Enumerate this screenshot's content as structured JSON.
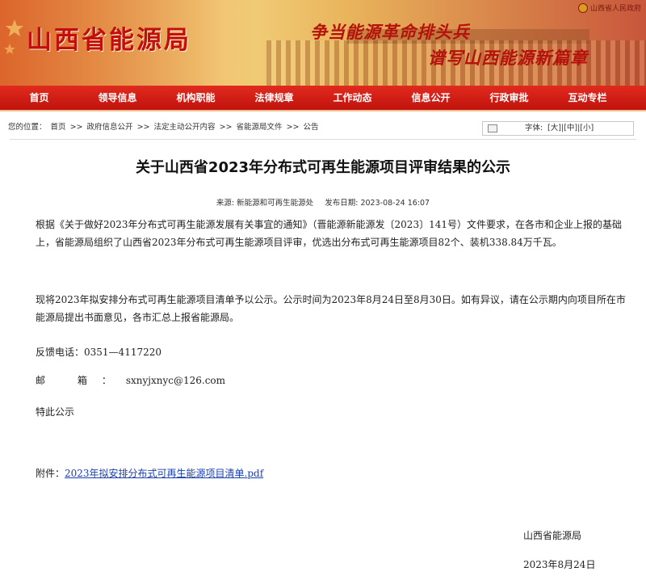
{
  "header": {
    "site_title": "山西省能源局",
    "slogan_line1": "争当能源革命排头兵",
    "slogan_line2": "谱写山西能源新篇章",
    "gov_link": "山西省人民政府"
  },
  "nav": {
    "items": [
      "首页",
      "领导信息",
      "机构职能",
      "法律规章",
      "工作动态",
      "信息公开",
      "行政审批",
      "互动专栏"
    ]
  },
  "breadcrumb": {
    "prefix": "您的位置：",
    "items": [
      "首页",
      "政府信息公开",
      "法定主动公开内容",
      "省能源局文件",
      "公告"
    ],
    "separator": ">>"
  },
  "font_size": {
    "label": "字体:",
    "options": [
      "大",
      "中",
      "小"
    ]
  },
  "article": {
    "title": "关于山西省2023年分布式可再生能源项目评审结果的公示",
    "source_label": "来源:",
    "source": "新能源和可再生能源处",
    "date_label": "发布日期:",
    "date": "2023-08-24 16:07",
    "paragraph1": "根据《关于做好2023年分布式可再生能源发展有关事宜的通知》（晋能源新能源发〔2023〕141号）文件要求，在各市和企业上报的基础上，省能源局组织了山西省2023年分布式可再生能源项目评审，优选出分布式可再生能源项目82个、装机338.84万千瓦。",
    "paragraph2": "现将2023年拟安排分布式可再生能源项目清单予以公示。公示时间为2023年8月24日至8月30日。如有异议，请在公示期内向项目所在市能源局提出书面意见，各市汇总上报省能源局。",
    "phone_label": "反馈电话：",
    "phone": "0351—4117220",
    "email_label": "邮 箱：",
    "email": "sxnyjxnyc@126.com",
    "closing": "特此公示",
    "attachment_label": "附件：",
    "attachment_link": "2023年拟安排分布式可再生能源项目清单.pdf",
    "signature": "山西省能源局",
    "sign_date": "2023年8月24日"
  },
  "colors": {
    "nav_red": "#d21d14",
    "title_red": "#c20e0e",
    "link_blue": "#1a3fb0"
  }
}
